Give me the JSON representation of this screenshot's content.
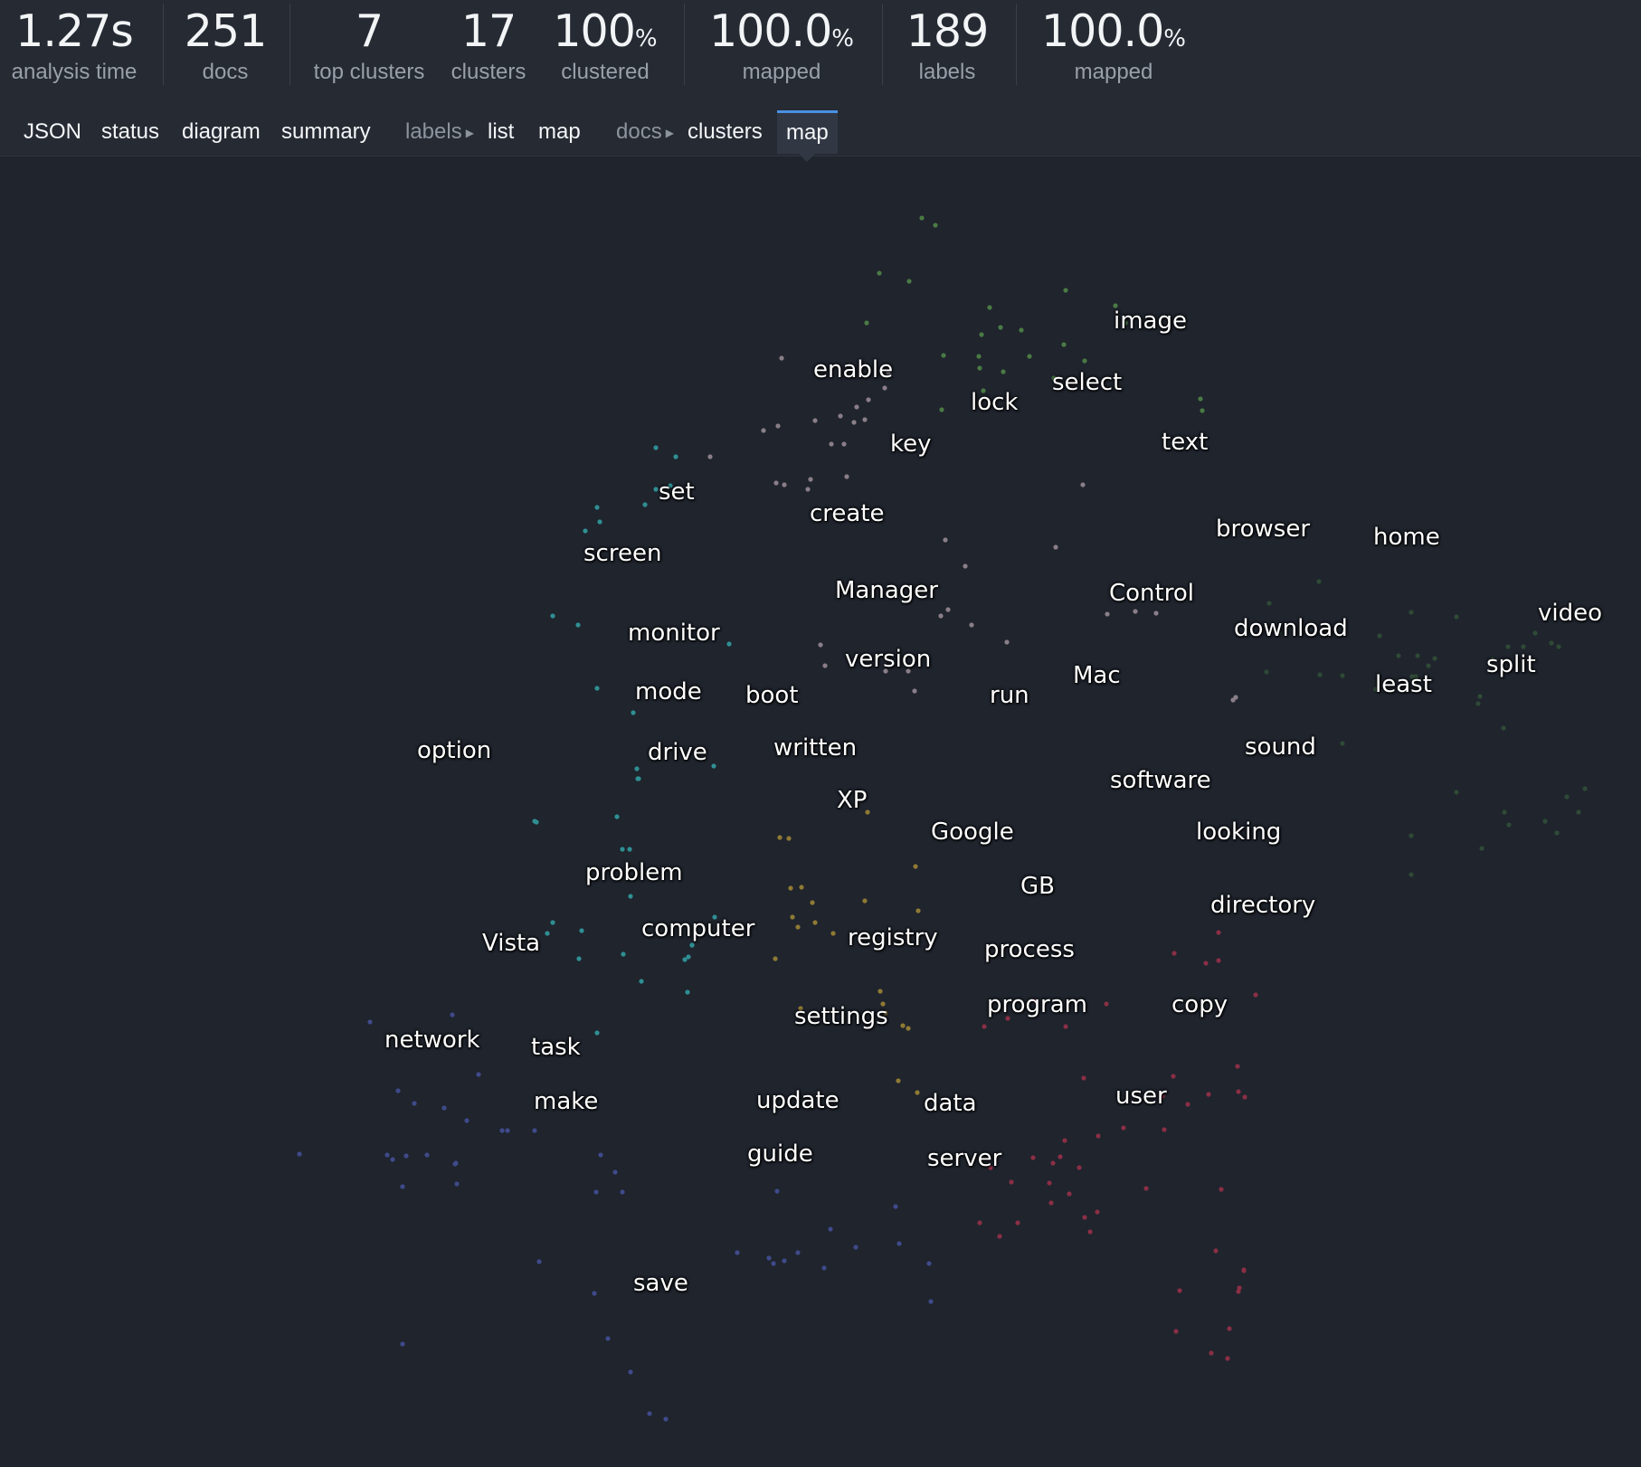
{
  "stats": [
    {
      "value": "1.27s",
      "unit": "",
      "label": "analysis time"
    },
    {
      "value": "251",
      "unit": "",
      "label": "docs"
    },
    {
      "value": "7",
      "unit": "",
      "label": "top clusters"
    },
    {
      "value": "17",
      "unit": "",
      "label": "clusters"
    },
    {
      "value": "100",
      "unit": "%",
      "label": "clustered"
    },
    {
      "value": "100.0",
      "unit": "%",
      "label": "mapped"
    },
    {
      "value": "189",
      "unit": "",
      "label": "labels"
    },
    {
      "value": "100.0",
      "unit": "%",
      "label": "mapped"
    }
  ],
  "tabs": {
    "json": "JSON",
    "status": "status",
    "diagram": "diagram",
    "summary": "summary",
    "labels_group": "labels",
    "labels_list": "list",
    "labels_map": "map",
    "docs_group": "docs",
    "docs_clusters": "clusters",
    "docs_map": "map",
    "active": "docs_map"
  },
  "colors": {
    "background": "#1f242d",
    "topbar": "#252a33",
    "accent": "#4a90e2",
    "cluster_green": "#4a7a44",
    "cluster_mauve": "#8a7e88",
    "cluster_teal": "#2f8f93",
    "cluster_olive": "#8f7a34",
    "cluster_crimson": "#8a2f45",
    "cluster_indigo": "#3f4a8a",
    "cluster_darkgreen": "#2f4a36"
  },
  "map_labels": [
    "image",
    "enable",
    "select",
    "lock",
    "key",
    "text",
    "set",
    "create",
    "browser",
    "home",
    "screen",
    "Manager",
    "Control",
    "video",
    "download",
    "monitor",
    "version",
    "split",
    "Mac",
    "least",
    "mode",
    "boot",
    "run",
    "option",
    "drive",
    "written",
    "sound",
    "software",
    "XP",
    "Google",
    "looking",
    "problem",
    "GB",
    "directory",
    "Vista",
    "computer",
    "registry",
    "process",
    "copy",
    "settings",
    "program",
    "network",
    "task",
    "user",
    "make",
    "update",
    "data",
    "guide",
    "server",
    "save"
  ]
}
